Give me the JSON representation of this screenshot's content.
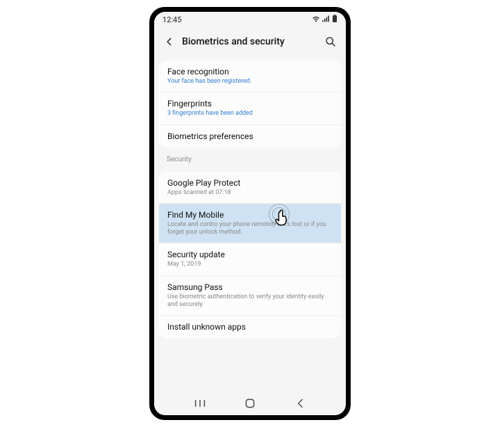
{
  "status": {
    "time": "12:45"
  },
  "header": {
    "title": "Biometrics and security"
  },
  "items": {
    "face": {
      "title": "Face recognition",
      "sub": "Your face has been registered."
    },
    "fingerprints": {
      "title": "Fingerprints",
      "sub": "3 fingerprints have been added"
    },
    "bioPrefs": {
      "title": "Biometrics preferences"
    },
    "sectionSecurity": "Security",
    "playProtect": {
      "title": "Google Play Protect",
      "sub": "Apps scanned at 07:18"
    },
    "findMyMobile": {
      "title": "Find My Mobile",
      "sub": "Locate and contro your phone remotely if it's lost or if you forget your unlock method."
    },
    "securityUpdate": {
      "title": "Security update",
      "sub": "May 1, 2019"
    },
    "samsungPass": {
      "title": "Samsung Pass",
      "sub": "Use biometric authentication to verify your identity easily and securely."
    },
    "unknownApps": {
      "title": "Install unknown apps"
    }
  }
}
